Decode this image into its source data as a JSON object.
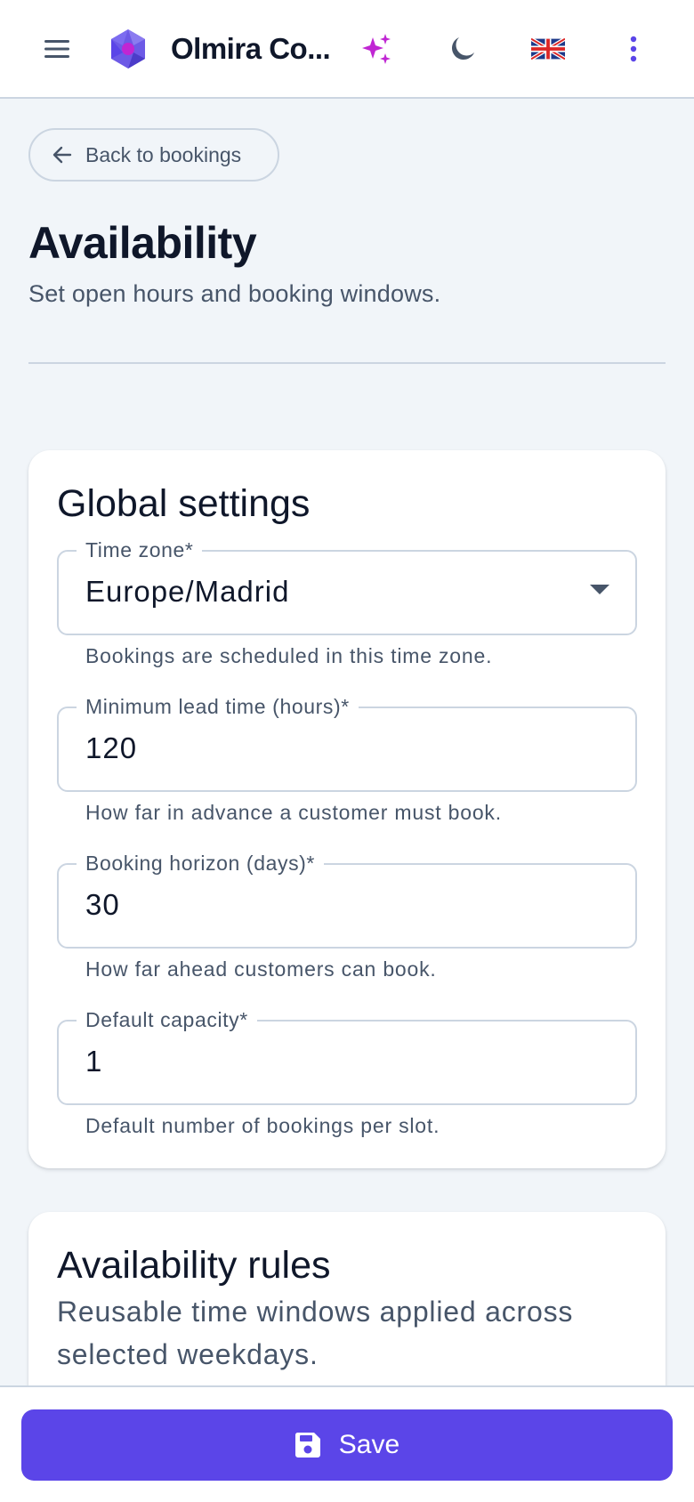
{
  "header": {
    "app_title": "Olmira Co...",
    "icons": [
      "menu-icon",
      "logo-icon",
      "sparkle-icon",
      "moon-icon",
      "uk-flag-icon",
      "more-vertical-icon"
    ]
  },
  "back_button": {
    "label": "Back to bookings",
    "icon": "arrow-left-icon"
  },
  "page": {
    "title": "Availability",
    "subtitle": "Set open hours and booking windows."
  },
  "global_settings": {
    "title": "Global settings",
    "fields": [
      {
        "label": "Time zone*",
        "value": "Europe/Madrid",
        "helper": "Bookings are scheduled in this time zone.",
        "type": "select"
      },
      {
        "label": "Minimum lead time (hours)*",
        "value": "120",
        "helper": "How far in advance a customer must book.",
        "type": "number"
      },
      {
        "label": "Booking horizon (days)*",
        "value": "30",
        "helper": "How far ahead customers can book.",
        "type": "number"
      },
      {
        "label": "Default capacity*",
        "value": "1",
        "helper": "Default number of bookings per slot.",
        "type": "number"
      }
    ]
  },
  "availability_rules": {
    "title": "Availability rules",
    "description": "Reusable time windows applied across selected weekdays."
  },
  "footer": {
    "save_label": "Save",
    "icon": "save-icon"
  },
  "colors": {
    "accent": "#5b45e8",
    "sparkle": "#c026d3",
    "background": "#f1f5f9",
    "border": "#cbd5e1",
    "text_primary": "#0f172a",
    "text_secondary": "#475569"
  }
}
